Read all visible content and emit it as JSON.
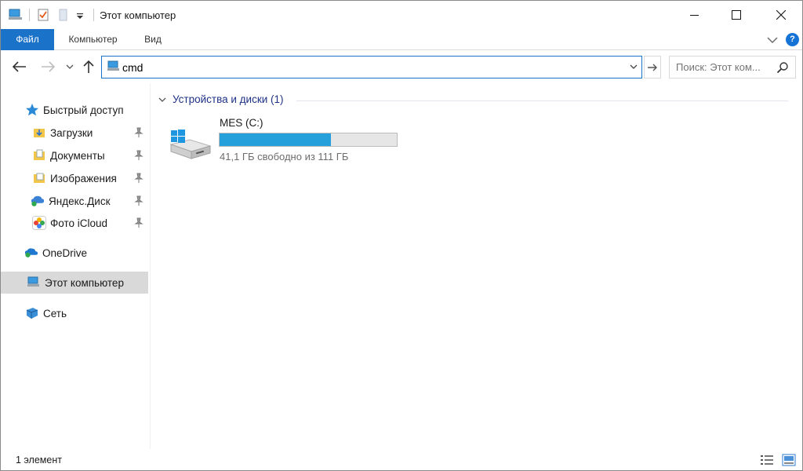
{
  "window": {
    "title": "Этот компьютер"
  },
  "ribbon": {
    "tabs": [
      {
        "label": "Файл"
      },
      {
        "label": "Компьютер"
      },
      {
        "label": "Вид"
      }
    ],
    "help_label": "?"
  },
  "address": {
    "value": "cmd"
  },
  "search": {
    "placeholder": "Поиск: Этот ком..."
  },
  "sidebar": {
    "items": [
      {
        "label": "Быстрый доступ",
        "icon": "star-icon"
      },
      {
        "label": "Загрузки",
        "icon": "downloads-folder-icon",
        "pinned": true
      },
      {
        "label": "Документы",
        "icon": "documents-folder-icon",
        "pinned": true
      },
      {
        "label": "Изображения",
        "icon": "pictures-folder-icon",
        "pinned": true
      },
      {
        "label": "Яндекс.Диск",
        "icon": "yandex-disk-icon",
        "pinned": true
      },
      {
        "label": "Фото iCloud",
        "icon": "icloud-photos-icon",
        "pinned": true
      },
      {
        "label": "OneDrive",
        "icon": "onedrive-icon"
      },
      {
        "label": "Этот компьютер",
        "icon": "computer-icon",
        "selected": true
      },
      {
        "label": "Сеть",
        "icon": "network-icon"
      }
    ]
  },
  "content": {
    "group_label": "Устройства и диски (1)",
    "drives": [
      {
        "name": "MES (C:)",
        "free_text": "41,1 ГБ свободно из 111 ГБ",
        "used_fraction": 0.63
      }
    ]
  },
  "status": {
    "count_text": "1 элемент"
  },
  "colors": {
    "accent": "#1a73c9",
    "drive_fill": "#26a0da",
    "group_header": "#1e3287",
    "selected_bg": "#d9d9d9"
  }
}
